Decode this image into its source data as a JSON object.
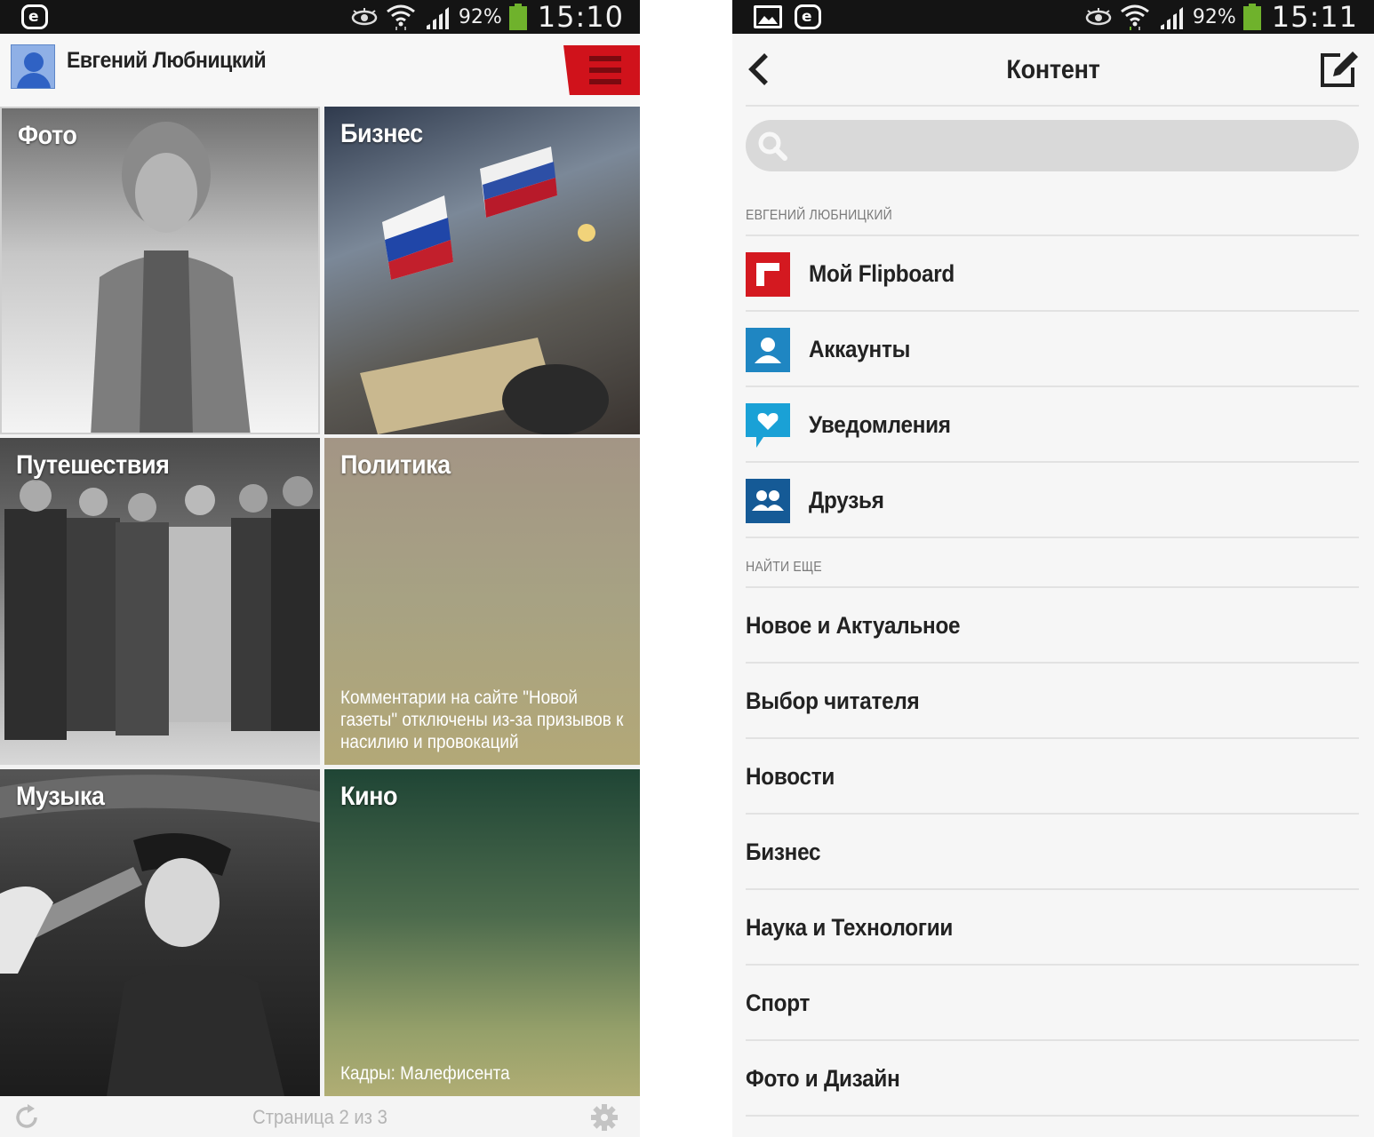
{
  "left": {
    "status": {
      "battery": "92%",
      "time": "15:10"
    },
    "user_name": "Евгений Любницкий",
    "tiles": [
      {
        "title": "Фото",
        "caption": ""
      },
      {
        "title": "Бизнес",
        "caption": ""
      },
      {
        "title": "Путешествия",
        "caption": ""
      },
      {
        "title": "Политика",
        "caption": "Комментарии на сайте \"Новой газеты\" отключены из-за призывов к насилию и провокаций"
      },
      {
        "title": "Музыка",
        "caption": ""
      },
      {
        "title": "Кино",
        "caption": "Кадры: Малефисента"
      }
    ],
    "footer": {
      "page_label": "Страница 2 из 3"
    }
  },
  "right": {
    "status": {
      "battery": "92%",
      "time": "15:11"
    },
    "title": "Контент",
    "search_placeholder": "",
    "section_user": "ЕВГЕНИЙ ЛЮБНИЦКИЙ",
    "user_items": [
      {
        "label": "Мой Flipboard",
        "icon": "flipboard-icon",
        "color": "#d41920"
      },
      {
        "label": "Аккаунты",
        "icon": "account-icon",
        "color": "#1f86c2"
      },
      {
        "label": "Уведомления",
        "icon": "heart-bubble-icon",
        "color": "#1aa1d6"
      },
      {
        "label": "Друзья",
        "icon": "friends-icon",
        "color": "#155a96"
      }
    ],
    "section_more": "НАЙТИ ЕЩЕ",
    "more_items": [
      "Новое и Актуальное",
      "Выбор читателя",
      "Новости",
      "Бизнес",
      "Наука и Технологии",
      "Спорт",
      "Фото и Дизайн"
    ]
  },
  "colors": {
    "accent_red": "#d0121b",
    "status_bar": "#141414",
    "battery_green": "#6fb22c"
  }
}
